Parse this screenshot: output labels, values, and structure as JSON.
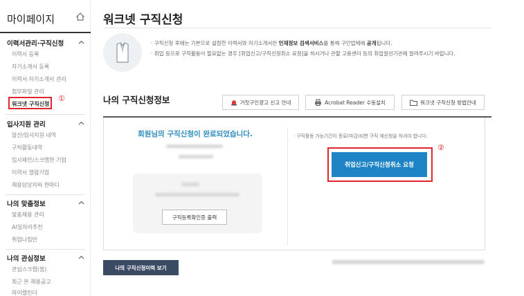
{
  "sidebar": {
    "title": "마이페이지",
    "sections": [
      {
        "title": "이력서관리·구직신청",
        "items": [
          "이력서 등록",
          "자기소개서 등록",
          "이력서·자기소개서 관리",
          "첨부파일 관리",
          "워크넷 구직신청"
        ]
      },
      {
        "title": "입사지원 관리",
        "items": [
          "알선/입사지원 내역",
          "구직활동내역",
          "입사제안/스크랩한 기업",
          "이력서 열람기업",
          "채용담당자와 한마디"
        ]
      },
      {
        "title": "나의 맞춤정보",
        "items": [
          "맞춤채용 관리",
          "AI일자리추천",
          "취업나침반"
        ]
      },
      {
        "title": "나의 관심정보",
        "items": [
          "관심스크랩(찜)",
          "최근 본 채용공고",
          "마이캘린더"
        ]
      }
    ]
  },
  "annotations": {
    "marker_1": "①",
    "marker_2": "②"
  },
  "main": {
    "page_title": "워크넷 구직신청",
    "notice": {
      "line1_prefix": "구직신청 후에는 기본으로 설정한 이력서와 자기소개서만 ",
      "line1_bold1": "인재정보 검색서비스",
      "line1_mid": "를 통해 구인업체에 ",
      "line1_bold2": "공개",
      "line1_suffix": "됩니다.",
      "line2": "취업 등으로 구직활동이 필요없는 경우 [취업신고/구직신청취소 요청]을 하시거나 관할 고용센터 등의 취업알선기관에 알려주시기 바랍니다."
    },
    "section_title": "나의 구직신청정보",
    "tool_buttons": {
      "false_ad": "거짓구인광고 신고 안내",
      "acrobat": "Acrobat Reader 수동설치",
      "guide": "워크넷 구직신청 방법안내"
    },
    "complete_message": "회원님의 구직신청이 완료되었습니다.",
    "cert_button": "구직등록확인증 출력",
    "right_note": "구직활동 가능기간이 종료(마감)되면 구직 재신청을 하셔야 합니다.",
    "cancel_button": "취업신고/구직신청취소 요청",
    "history_button": "나의 구직신청이력 보기"
  },
  "colors": {
    "accent_blue": "#1e84c5",
    "highlight_red": "#e0252b",
    "dark_button": "#3b4a63",
    "message_blue": "#2a8bbd"
  },
  "icons": {
    "home": "home-icon",
    "caret": "chevron-up-icon",
    "alert": "siren-icon",
    "printer": "printer-icon",
    "folder": "folder-icon",
    "notice": "shirt-icon"
  }
}
